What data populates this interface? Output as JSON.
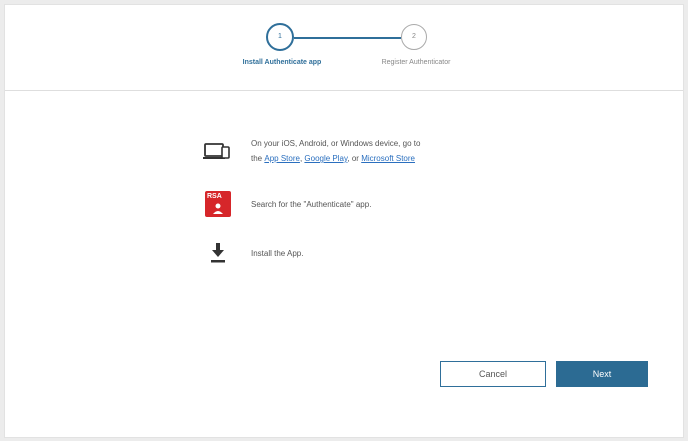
{
  "stepper": {
    "steps": [
      {
        "number": "1",
        "label": "Install Authenticate app",
        "state": "active"
      },
      {
        "number": "2",
        "label": "Register Authenticator",
        "state": "inactive"
      }
    ]
  },
  "instructions": [
    {
      "icon": "devices-icon",
      "line1": "On your iOS, Android, or Windows device, go to",
      "prefix": "the",
      "links": [
        "App Store",
        "Google Play",
        "Microsoft Store"
      ],
      "sep1": ",",
      "sep2": ", or"
    },
    {
      "icon": "rsa-app-icon",
      "icon_text": "RSA",
      "text": "Search for the \"Authenticate\" app."
    },
    {
      "icon": "download-icon",
      "text": "Install the App."
    }
  ],
  "buttons": {
    "cancel": "Cancel",
    "next": "Next"
  },
  "colors": {
    "primary": "#2c6b93",
    "link": "#2a6fbf",
    "rsa_red": "#d6262a"
  }
}
